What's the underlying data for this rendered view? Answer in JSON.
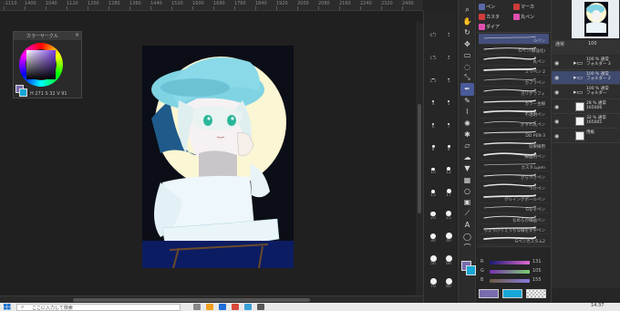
{
  "ruler": {
    "ticks": [
      "-1110",
      "1400",
      "1040",
      "1120",
      "1200",
      "1280",
      "1360",
      "1440",
      "1520",
      "1600",
      "1680",
      "1760",
      "1840",
      "1920",
      "2000",
      "2080",
      "2160",
      "2240",
      "2320",
      "2400"
    ]
  },
  "color_panel": {
    "title": "カラーサークル",
    "close": "×",
    "values": "H 271  S 32  V 91",
    "main_color": "#7a6bb0",
    "sub_color": "#17a7d6"
  },
  "brush_sizes": [
    {
      "label": "0.7",
      "d": 1
    },
    {
      "label": "1",
      "d": 1
    },
    {
      "label": "1.5",
      "d": 1
    },
    {
      "label": "2",
      "d": 1
    },
    {
      "label": "2.5",
      "d": 1.5
    },
    {
      "label": "3",
      "d": 1.5
    },
    {
      "label": "4",
      "d": 2
    },
    {
      "label": "5",
      "d": 2
    },
    {
      "label": "6",
      "d": 2.5
    },
    {
      "label": "7",
      "d": 2.5
    },
    {
      "label": "8",
      "d": 3
    },
    {
      "label": "9",
      "d": 3
    },
    {
      "label": "10",
      "d": 3.5
    },
    {
      "label": "12",
      "d": 4
    },
    {
      "label": "15",
      "d": 4.5
    },
    {
      "label": "17",
      "d": 5
    },
    {
      "label": "20",
      "d": 5.5
    },
    {
      "label": "25",
      "d": 6
    },
    {
      "label": "30",
      "d": 6.5
    },
    {
      "label": "40",
      "d": 7
    },
    {
      "label": "50",
      "d": 7
    },
    {
      "label": "60",
      "d": 7
    },
    {
      "label": "70",
      "d": 7
    },
    {
      "label": "80",
      "d": 7
    }
  ],
  "tools": [
    "search-icon",
    "hand-icon",
    "rotate-icon",
    "move-icon",
    "selection-icon",
    "lasso-icon",
    "eyedropper-icon",
    "pen-icon",
    "pencil-icon",
    "brush-icon",
    "airbrush-icon",
    "decoration-icon",
    "eraser-icon",
    "blend-icon",
    "fill-icon",
    "gradient-icon",
    "figure-icon",
    "frame-icon",
    "ruler-icon",
    "text-icon",
    "balloon-icon",
    "line-correction-icon"
  ],
  "subtool": {
    "tabs": [
      {
        "label": "ペン",
        "color": "#5a6aa8"
      },
      {
        "label": "マーカ",
        "color": "#d03b3b"
      },
      {
        "label": "カスタ",
        "color": "#d03b3b"
      },
      {
        "label": "丸ペン",
        "color": "#e04fb0"
      },
      {
        "label": "ダイア",
        "color": "#e04fb0"
      }
    ],
    "brushes": [
      {
        "name": "Gペン",
        "selected": true
      },
      {
        "name": "Gペン(線強化)",
        "selected": false
      },
      {
        "name": "丸ペン",
        "selected": false
      },
      {
        "name": "ミリペン 2",
        "selected": false
      },
      {
        "name": "カブラペン",
        "selected": false
      },
      {
        "name": "カリグラフィ",
        "selected": false
      },
      {
        "name": "カラー主線",
        "selected": false
      },
      {
        "name": "不透明ペン",
        "selected": false
      },
      {
        "name": "かすれ丸ペン",
        "selected": false
      },
      {
        "name": "DD PEN 3",
        "selected": false
      },
      {
        "name": "効果線用",
        "selected": false
      },
      {
        "name": "線画用ペン",
        "selected": false
      },
      {
        "name": "カスタムpen",
        "selected": false
      },
      {
        "name": "ざらつきペン",
        "selected": false
      },
      {
        "name": "つけペン",
        "selected": false
      },
      {
        "name": "グルイングボールペン",
        "selected": false
      },
      {
        "name": "Gなぞペン",
        "selected": false
      },
      {
        "name": "なめらか線画ペン",
        "selected": false
      },
      {
        "name": "ちょっぴりえっちな線を文字ペン",
        "selected": false
      },
      {
        "name": "Gペンカスタム2",
        "selected": false
      }
    ],
    "sliders": [
      {
        "label": "R",
        "value": "131",
        "gradient": "linear-gradient(to right,#1a1a70,#e06bd0)"
      },
      {
        "label": "G",
        "value": "105",
        "gradient": "linear-gradient(to right,#7a2fb0,#7ad070)"
      },
      {
        "label": "B",
        "value": "155",
        "gradient": "linear-gradient(to right,#6a5a40,#8a7ae0)"
      }
    ]
  },
  "layers": [
    {
      "name": "100 % 通常\nフォルダー 3",
      "type": "folder",
      "selected": false
    },
    {
      "name": "100 % 通常\nフォルダー 2",
      "type": "folder",
      "selected": true
    },
    {
      "name": "100 % 通常\nフォルダー",
      "type": "folder",
      "selected": false
    },
    {
      "name": "28 % 通常\n165006",
      "type": "raster",
      "selected": false
    },
    {
      "name": "32 % 通常\n165005",
      "type": "raster",
      "selected": false
    },
    {
      "name": "用紙",
      "type": "paper",
      "selected": false
    }
  ],
  "layer_toolbar": {
    "mode": "通常",
    "opacity": "100"
  },
  "taskbar": {
    "search_placeholder": "ここに入力して検索",
    "clock": "14:37"
  }
}
